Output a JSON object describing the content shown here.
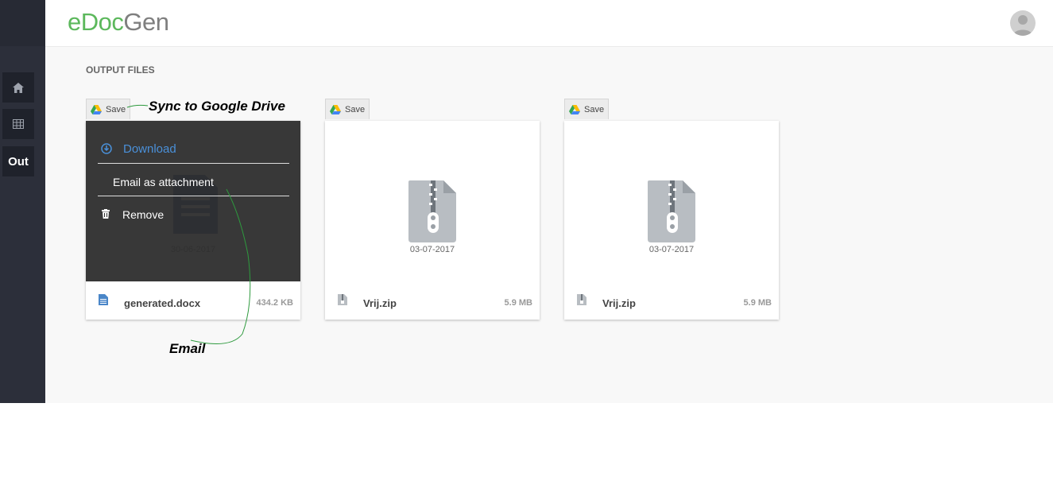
{
  "app": {
    "logo_part1": "eDoc",
    "logo_part2": "Gen"
  },
  "sidebar": {
    "items": [
      {
        "icon": "home-icon"
      },
      {
        "icon": "table-icon"
      },
      {
        "label": "Out"
      }
    ]
  },
  "section": {
    "title": "OUTPUT FILES"
  },
  "files": [
    {
      "save_label": "Save",
      "date": "30-06-2017",
      "name": "generated.docx",
      "size": "434.2 KB",
      "menu": {
        "download": "Download",
        "email": "Email as attachment",
        "remove": "Remove"
      }
    },
    {
      "save_label": "Save",
      "date": "03-07-2017",
      "name": "Vrij.zip",
      "size": "5.9 MB"
    },
    {
      "save_label": "Save",
      "date": "03-07-2017",
      "name": "Vrij.zip",
      "size": "5.9 MB"
    }
  ],
  "annotations": {
    "sync": "Sync to Google Drive",
    "email": "Email"
  },
  "colors": {
    "accent_green": "#5cb85c",
    "sidebar": "#2c2f3a",
    "link_blue": "#4a90d9"
  }
}
